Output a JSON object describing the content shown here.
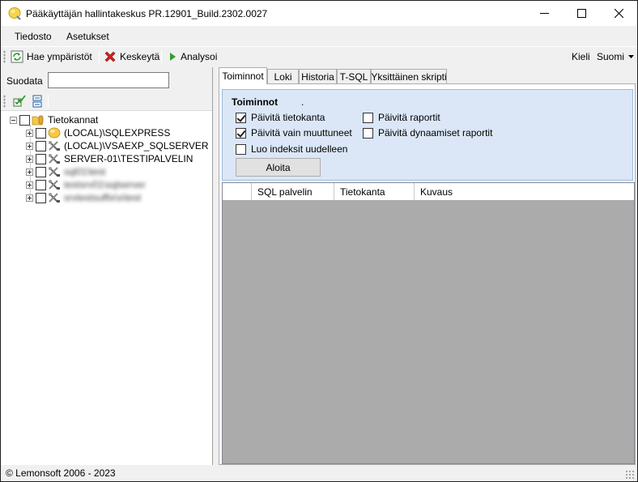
{
  "window": {
    "title": "Pääkäyttäjän hallintakeskus PR.12901_Build.2302.0027"
  },
  "menu": {
    "items": [
      "Tiedosto",
      "Asetukset"
    ]
  },
  "toolbar": {
    "fetch_label": "Hae ympäristöt",
    "stop_label": "Keskeytä",
    "analyze_label": "Analysoi",
    "language_label": "Kieli",
    "language_value": "Suomi"
  },
  "left": {
    "filter_label": "Suodata",
    "filter_value": "",
    "tree": {
      "root_label": "Tietokannat",
      "nodes": [
        {
          "label": "(LOCAL)\\SQLEXPRESS",
          "blurred": false
        },
        {
          "label": "(LOCAL)\\VSAEXP_SQLSERVER",
          "blurred": false
        },
        {
          "label": "SERVER-01\\TESTIPALVELIN",
          "blurred": false
        },
        {
          "label": "sql01\\test",
          "blurred": true
        },
        {
          "label": "testsrv01\\sqlserver",
          "blurred": true
        },
        {
          "label": "srvtestsuffix\\x\\test",
          "blurred": true
        }
      ]
    }
  },
  "tabs": [
    "Toiminnot",
    "Loki",
    "Historia",
    "T-SQL",
    "Yksittäinen skripti"
  ],
  "actions": {
    "title": "Toiminnot",
    "dot": ".",
    "checkboxes_left": [
      {
        "label": "Päivitä tietokanta",
        "checked": true
      },
      {
        "label": "Päivitä vain muuttuneet",
        "checked": true
      },
      {
        "label": "Luo indeksit uudelleen",
        "checked": false
      }
    ],
    "checkboxes_right": [
      {
        "label": "Päivitä raportit",
        "checked": false
      },
      {
        "label": "Päivitä dynaamiset raportit",
        "checked": false
      }
    ],
    "start_label": "Aloita"
  },
  "grid": {
    "columns": [
      "",
      "SQL palvelin",
      "Tietokanta",
      "Kuvaus"
    ]
  },
  "status": {
    "text": "© Lemonsoft 2006 - 2023"
  }
}
